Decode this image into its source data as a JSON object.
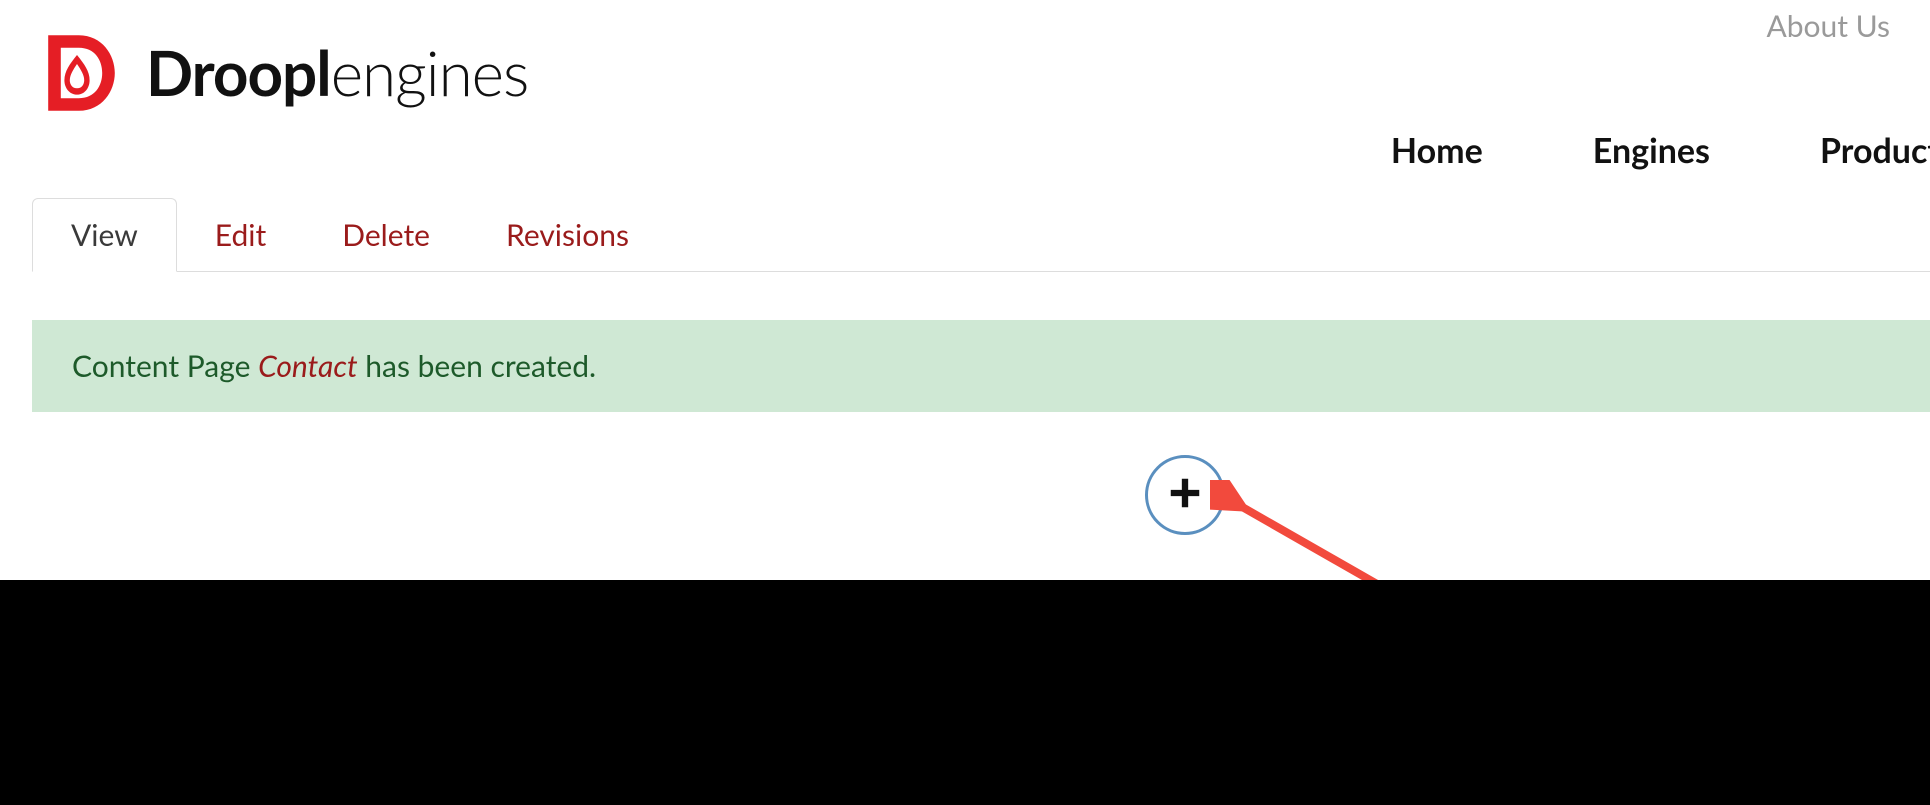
{
  "topnav": {
    "about": "About Us"
  },
  "logo": {
    "bold": "Droopl",
    "light": "engines"
  },
  "mainnav": {
    "items": [
      {
        "label": "Home"
      },
      {
        "label": "Engines"
      },
      {
        "label": "Product"
      }
    ]
  },
  "tabs": {
    "items": [
      {
        "label": "View",
        "active": true
      },
      {
        "label": "Edit",
        "active": false
      },
      {
        "label": "Delete",
        "active": false
      },
      {
        "label": "Revisions",
        "active": false
      }
    ]
  },
  "status": {
    "prefix": "Content Page ",
    "link": "Contact",
    "suffix": " has been created."
  },
  "icons": {
    "add": "plus-icon"
  },
  "colors": {
    "brand_red": "#e51e25",
    "link_maroon": "#9a1b1b",
    "success_bg": "#cfe8d4",
    "success_text": "#1d5a2a",
    "add_outline": "#5a8fbf",
    "arrow": "#f24a3d"
  }
}
